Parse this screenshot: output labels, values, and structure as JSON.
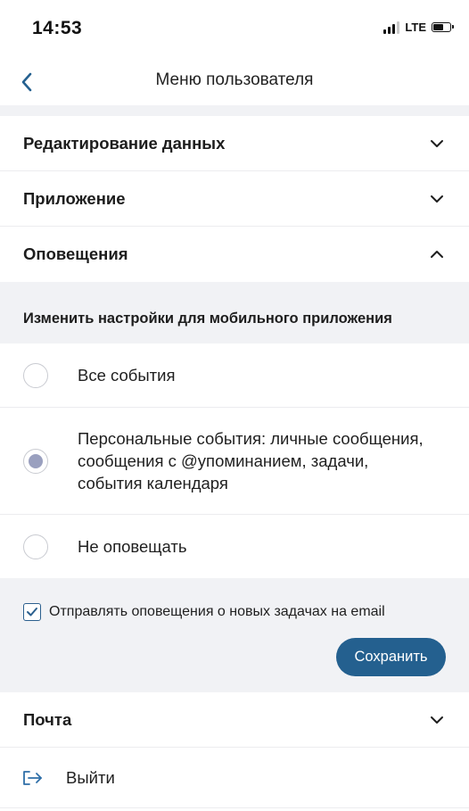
{
  "status_bar": {
    "time": "14:53",
    "network": "LTE"
  },
  "header": {
    "title": "Меню пользователя",
    "back_icon": "chevron-left-icon"
  },
  "sections": [
    {
      "label": "Редактирование данных",
      "expanded": false
    },
    {
      "label": "Приложение",
      "expanded": false
    },
    {
      "label": "Оповещения",
      "expanded": true
    },
    {
      "label": "Почта",
      "expanded": false
    }
  ],
  "notifications": {
    "subheader": "Изменить настройки для мобильного приложения",
    "options": [
      {
        "label": "Все события",
        "selected": false
      },
      {
        "label": "Персональные события: личные сообщения, сообщения с @упоминанием, задачи, события календаря",
        "selected": true
      },
      {
        "label": "Не оповещать",
        "selected": false
      }
    ],
    "email_checkbox": {
      "label": "Отправлять оповещения о новых задачах на email",
      "checked": true
    },
    "save_label": "Сохранить"
  },
  "logout": {
    "label": "Выйти",
    "icon": "logout-icon"
  },
  "colors": {
    "accent": "#24608f",
    "section_bg": "#f1f2f5",
    "radio_selected": "#9aa0bf"
  }
}
